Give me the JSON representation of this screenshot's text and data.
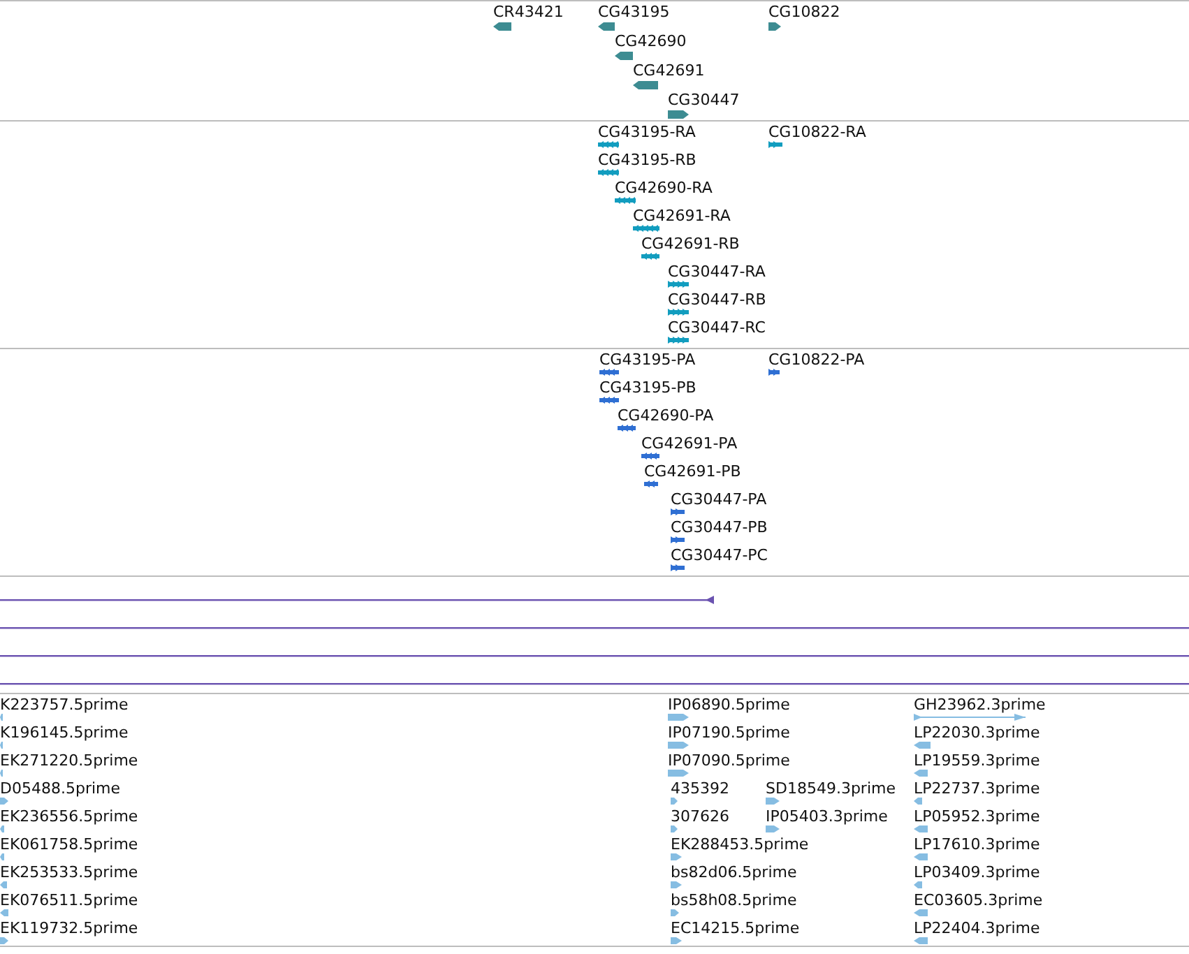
{
  "tracks": [
    {
      "kind": "genes",
      "color": "#3d8c92",
      "features": [
        {
          "label": "CR43421",
          "reverse": true
        },
        {
          "label": "CG43195",
          "reverse": true
        },
        {
          "label": "CG10822",
          "reverse": false
        },
        {
          "label": "CG42690",
          "reverse": true
        },
        {
          "label": "CG42691",
          "reverse": true
        },
        {
          "label": "CG30447",
          "reverse": false
        }
      ]
    },
    {
      "kind": "transcripts",
      "color": "#129dbf",
      "features": [
        {
          "label": "CG43195-RA",
          "reverse": true
        },
        {
          "label": "CG10822-RA",
          "reverse": false
        },
        {
          "label": "CG43195-RB",
          "reverse": true
        },
        {
          "label": "CG42690-RA",
          "reverse": true
        },
        {
          "label": "CG42691-RA",
          "reverse": true
        },
        {
          "label": "CG42691-RB",
          "reverse": true
        },
        {
          "label": "CG30447-RA",
          "reverse": false
        },
        {
          "label": "CG30447-RB",
          "reverse": false
        },
        {
          "label": "CG30447-RC",
          "reverse": false
        }
      ]
    },
    {
      "kind": "proteins",
      "color": "#2f6fd3",
      "features": [
        {
          "label": "CG43195-PA",
          "reverse": true
        },
        {
          "label": "CG10822-PA",
          "reverse": false
        },
        {
          "label": "CG43195-PB",
          "reverse": true
        },
        {
          "label": "CG42690-PA",
          "reverse": true
        },
        {
          "label": "CG42691-PA",
          "reverse": true
        },
        {
          "label": "CG42691-PB",
          "reverse": true
        },
        {
          "label": "CG30447-PA",
          "reverse": false
        },
        {
          "label": "CG30447-PB",
          "reverse": false
        },
        {
          "label": "CG30447-PC",
          "reverse": false
        }
      ]
    },
    {
      "kind": "alignments",
      "color": "#6a52b0",
      "lines": [
        {
          "arrow_head": true
        },
        {
          "arrow_head": false
        },
        {
          "arrow_head": false
        },
        {
          "arrow_head": false
        }
      ]
    },
    {
      "kind": "ests",
      "color": "#86bde2",
      "features": [
        {
          "label": "K223757.5prime",
          "reverse": true
        },
        {
          "label": "IP06890.5prime",
          "reverse": false
        },
        {
          "label": "GH23962.3prime",
          "reverse": false,
          "spliced": true
        },
        {
          "label": "K196145.5prime",
          "reverse": true
        },
        {
          "label": "IP07190.5prime",
          "reverse": false
        },
        {
          "label": "LP22030.3prime",
          "reverse": true
        },
        {
          "label": "EK271220.5prime",
          "reverse": true
        },
        {
          "label": "IP07090.5prime",
          "reverse": false
        },
        {
          "label": "LP19559.3prime",
          "reverse": true
        },
        {
          "label": "D05488.5prime",
          "reverse": false
        },
        {
          "label": "435392",
          "reverse": false
        },
        {
          "label": "SD18549.3prime",
          "reverse": false
        },
        {
          "label": "LP22737.3prime",
          "reverse": true
        },
        {
          "label": "EK236556.5prime",
          "reverse": true
        },
        {
          "label": "307626",
          "reverse": false
        },
        {
          "label": "IP05403.3prime",
          "reverse": false
        },
        {
          "label": "LP05952.3prime",
          "reverse": true
        },
        {
          "label": "EK061758.5prime",
          "reverse": true
        },
        {
          "label": "EK288453.5prime",
          "reverse": false
        },
        {
          "label": "LP17610.3prime",
          "reverse": true
        },
        {
          "label": "EK253533.5prime",
          "reverse": true
        },
        {
          "label": "bs82d06.5prime",
          "reverse": false
        },
        {
          "label": "LP03409.3prime",
          "reverse": true
        },
        {
          "label": "EK076511.5prime",
          "reverse": true
        },
        {
          "label": "bs58h08.5prime",
          "reverse": false
        },
        {
          "label": "EC03605.3prime",
          "reverse": true
        },
        {
          "label": "EK119732.5prime",
          "reverse": false
        },
        {
          "label": "EC14215.5prime",
          "reverse": false
        },
        {
          "label": "LP22404.3prime",
          "reverse": true
        }
      ]
    }
  ]
}
